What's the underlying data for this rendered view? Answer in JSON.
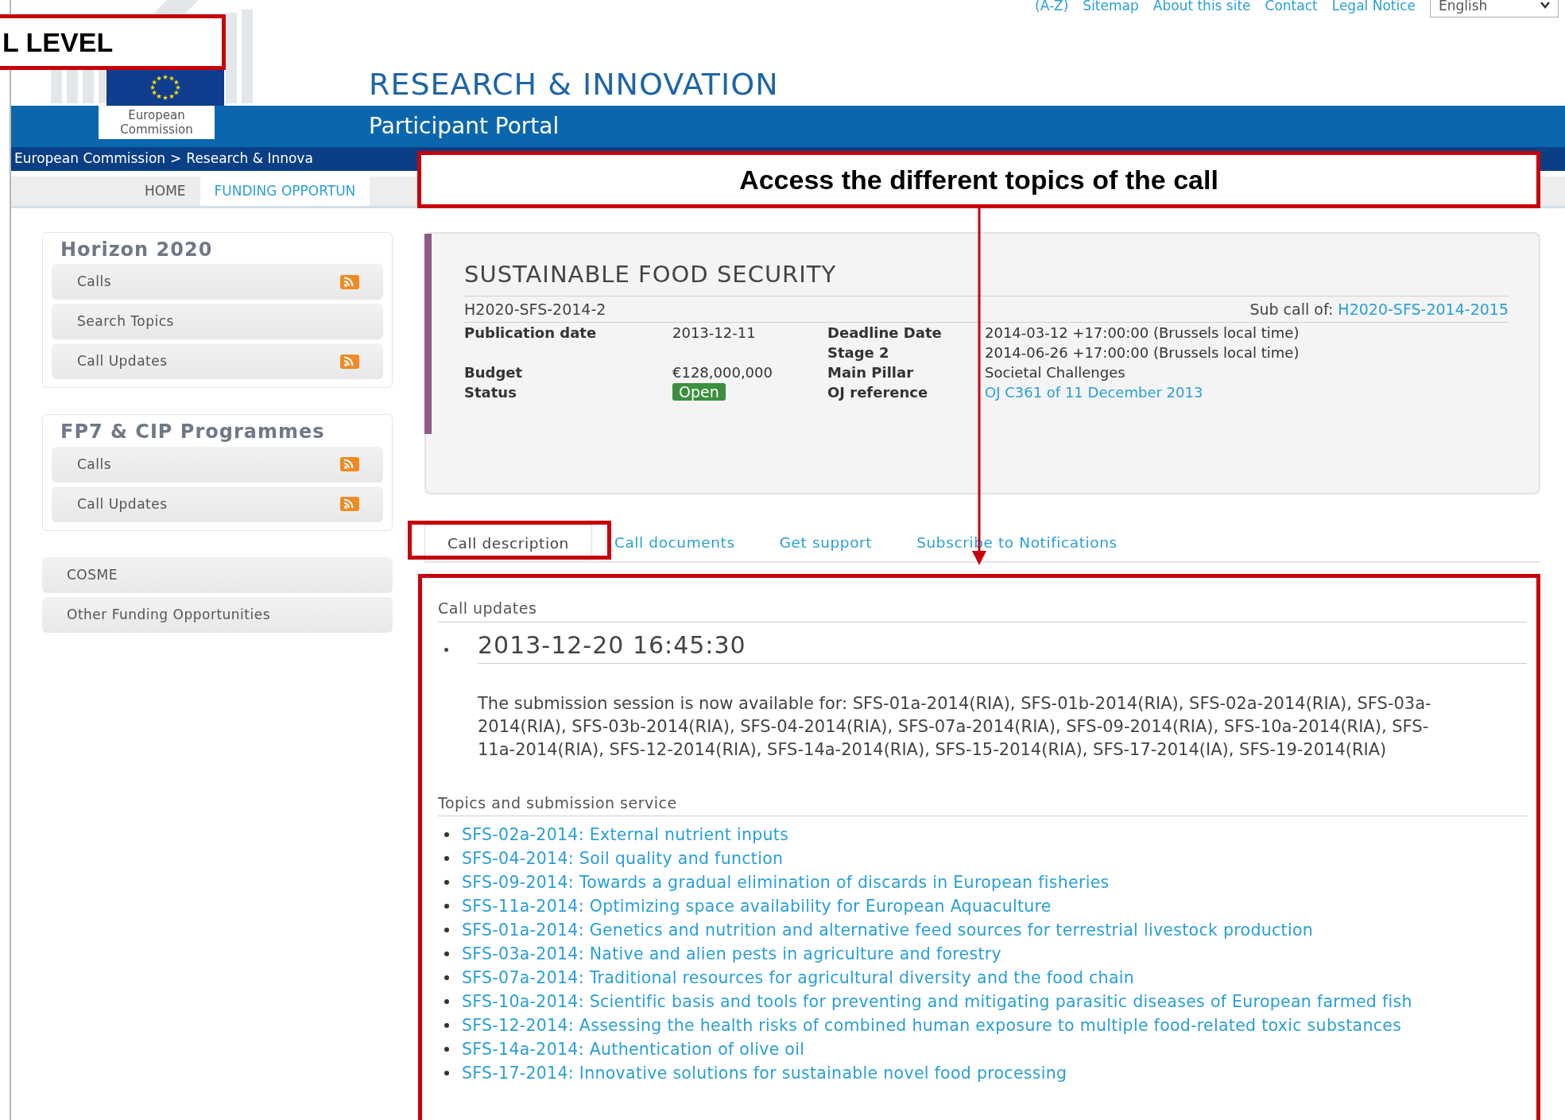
{
  "annotations": [
    {
      "kind": "label",
      "text": "L LEVEL"
    },
    {
      "kind": "callout",
      "text": "Access the different topics of the call"
    }
  ],
  "header": {
    "top_links": [
      "(A-Z)",
      "Sitemap",
      "About this site",
      "Contact",
      "Legal Notice"
    ],
    "language": "English",
    "logo_text": "European Commission",
    "site_title": "RESEARCH & INNOVATION",
    "portal_title": "Participant Portal"
  },
  "breadcrumb": {
    "items": [
      "European Commission",
      "Research & Innova"
    ],
    "separator": ">"
  },
  "nav": [
    {
      "label": "HOME",
      "selected": false
    },
    {
      "label": "FUNDING OPPORTUN",
      "selected": true
    }
  ],
  "sidebar": {
    "groups": [
      {
        "title": "Horizon 2020",
        "items": [
          {
            "label": "Calls",
            "rss": true
          },
          {
            "label": "Search Topics",
            "rss": false
          },
          {
            "label": "Call Updates",
            "rss": true
          }
        ]
      },
      {
        "title": "FP7 & CIP Programmes",
        "items": [
          {
            "label": "Calls",
            "rss": true
          },
          {
            "label": "Call Updates",
            "rss": true
          }
        ]
      }
    ],
    "links": [
      "COSME",
      "Other Funding Opportunities"
    ]
  },
  "call": {
    "title": "SUSTAINABLE FOOD SECURITY",
    "identifier": "H2020-SFS-2014-2",
    "sub_call_label": "Sub call of:",
    "sub_call": "H2020-SFS-2014-2015",
    "rows": [
      {
        "left": {
          "label": "Publication date",
          "value": "2013-12-11",
          "kind": "text"
        },
        "right": {
          "label": "Deadline Date",
          "value": "2014-03-12 +17:00:00 (Brussels local time)",
          "kind": "text"
        }
      },
      {
        "right": {
          "label": "Stage 2",
          "value": "2014-06-26 +17:00:00 (Brussels local time)",
          "kind": "text"
        }
      },
      {
        "left": {
          "label": "Budget",
          "value": "€128,000,000",
          "kind": "text"
        },
        "right": {
          "label": "Main Pillar",
          "value": "Societal Challenges",
          "kind": "text"
        }
      },
      {
        "left": {
          "label": "Status",
          "value": "Open",
          "kind": "badge"
        },
        "right": {
          "label": "OJ reference",
          "value": "OJ C361 of 11 December 2013",
          "kind": "link"
        }
      }
    ]
  },
  "tabs": [
    {
      "label": "Call description",
      "selected": true
    },
    {
      "label": "Call documents",
      "selected": false
    },
    {
      "label": "Get support",
      "selected": false
    },
    {
      "label": "Subscribe to Notifications",
      "selected": false
    }
  ],
  "call_updates": {
    "heading": "Call updates",
    "entries": [
      {
        "time": "2013-12-20 16:45:30",
        "text": "The submission session is now available for: SFS-01a-2014(RIA), SFS-01b-2014(RIA), SFS-02a-2014(RIA), SFS-03a-2014(RIA), SFS-03b-2014(RIA), SFS-04-2014(RIA), SFS-07a-2014(RIA), SFS-09-2014(RIA), SFS-10a-2014(RIA), SFS-11a-2014(RIA), SFS-12-2014(RIA), SFS-14a-2014(RIA), SFS-15-2014(RIA), SFS-17-2014(IA), SFS-19-2014(RIA)"
      }
    ]
  },
  "topics": {
    "heading": "Topics and submission service",
    "items": [
      "SFS-02a-2014: External nutrient inputs",
      "SFS-04-2014: Soil quality and function",
      "SFS-09-2014: Towards a gradual elimination of discards in European fisheries",
      "SFS-11a-2014: Optimizing space availability for European Aquaculture",
      "SFS-01a-2014: Genetics and nutrition and alternative feed sources for terrestrial livestock production",
      "SFS-03a-2014: Native and alien pests in agriculture and forestry",
      "SFS-07a-2014: Traditional resources for agricultural diversity and the food chain",
      "SFS-10a-2014: Scientific basis and tools for preventing and mitigating parasitic diseases of European farmed fish",
      "SFS-12-2014: Assessing the health risks of combined human exposure to multiple food-related toxic substances",
      "SFS-14a-2014: Authentication of olive oil",
      "SFS-17-2014: Innovative solutions for sustainable novel food processing"
    ]
  }
}
